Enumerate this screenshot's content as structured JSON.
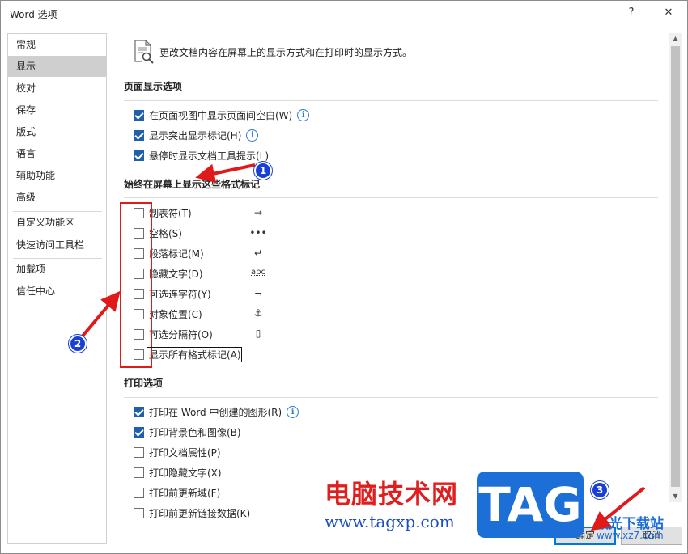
{
  "window": {
    "title": "Word 选项",
    "help_glyph": "?",
    "close_glyph": "✕"
  },
  "nav": {
    "items": [
      {
        "label": "常规",
        "selected": false
      },
      {
        "label": "显示",
        "selected": true
      },
      {
        "label": "校对",
        "selected": false
      },
      {
        "label": "保存",
        "selected": false
      },
      {
        "label": "版式",
        "selected": false
      },
      {
        "label": "语言",
        "selected": false
      },
      {
        "label": "辅助功能",
        "selected": false
      },
      {
        "label": "高级",
        "selected": false
      },
      {
        "label": "自定义功能区",
        "selected": false
      },
      {
        "label": "快速访问工具栏",
        "selected": false
      },
      {
        "label": "加载项",
        "selected": false
      },
      {
        "label": "信任中心",
        "selected": false
      }
    ]
  },
  "header": {
    "text": "更改文档内容在屏幕上的显示方式和在打印时的显示方式。",
    "icon": "document-search-icon"
  },
  "page_display": {
    "title": "页面显示选项",
    "options": [
      {
        "label": "在页面视图中显示页面间空白(W)",
        "checked": true,
        "info": "i"
      },
      {
        "label": "显示突出显示标记(H)",
        "checked": true,
        "info": "i"
      },
      {
        "label": "悬停时显示文档工具提示(L)",
        "checked": true,
        "info": ""
      }
    ]
  },
  "format_marks": {
    "title": "始终在屏幕上显示这些格式标记",
    "options": [
      {
        "label": "制表符(T)",
        "checked": false,
        "symbol": "→"
      },
      {
        "label": "空格(S)",
        "checked": false,
        "symbol": "•••"
      },
      {
        "label": "段落标记(M)",
        "checked": false,
        "symbol": "↵"
      },
      {
        "label": "隐藏文字(D)",
        "checked": false,
        "symbol": "abc"
      },
      {
        "label": "可选连字符(Y)",
        "checked": false,
        "symbol": "¬"
      },
      {
        "label": "对象位置(C)",
        "checked": false,
        "symbol": "⚓"
      },
      {
        "label": "可选分隔符(O)",
        "checked": false,
        "symbol": "▯"
      },
      {
        "label": "显示所有格式标记(A)",
        "checked": false,
        "symbol": ""
      }
    ]
  },
  "print": {
    "title": "打印选项",
    "options": [
      {
        "label": "打印在 Word 中创建的图形(R)",
        "checked": true,
        "info": "i"
      },
      {
        "label": "打印背景色和图像(B)",
        "checked": true,
        "info": ""
      },
      {
        "label": "打印文档属性(P)",
        "checked": false,
        "info": ""
      },
      {
        "label": "打印隐藏文字(X)",
        "checked": false,
        "info": ""
      },
      {
        "label": "打印前更新域(F)",
        "checked": false,
        "info": ""
      },
      {
        "label": "打印前更新链接数据(K)",
        "checked": false,
        "info": ""
      }
    ]
  },
  "buttons": {
    "ok": "确定",
    "cancel": "取消"
  },
  "annotations": {
    "badge1": "1",
    "badge2": "2",
    "badge3": "3",
    "color": "#e01919"
  },
  "watermark": {
    "cn": "电脑技术网",
    "url": "www.tagxp.com",
    "tag": "TAG",
    "xz": "极光下载站",
    "xz_url": "www.xz7.com"
  }
}
